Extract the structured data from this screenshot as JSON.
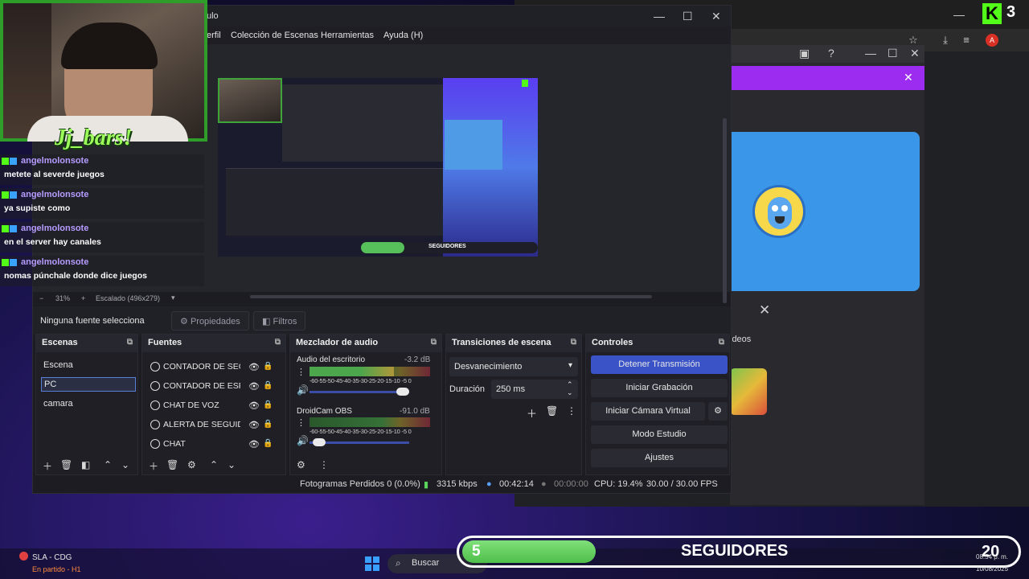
{
  "browser": {
    "profile_initial": "A",
    "kick_count": "3"
  },
  "dialog": {
    "videos_text": "ideos"
  },
  "obs": {
    "title": "ulo",
    "menu": [
      "erfil",
      "Colección de Escenas",
      "Herramientas",
      "Ayuda (H)"
    ],
    "zoom": "31%",
    "scale_label": "Escalado (496x279)",
    "no_source": "Ninguna fuente seleccionada",
    "properties_btn": "Propiedades",
    "filters_btn": "Filtros",
    "docks": {
      "scenes": "Escenas",
      "sources": "Fuentes",
      "mixer": "Mezclador de audio",
      "transitions": "Transiciones de escena",
      "controls": "Controles"
    },
    "scenes": [
      "Escena",
      "PC",
      "camara"
    ],
    "sources": [
      "CONTADOR DE SEGUIDORES",
      "CONTADOR DE ESPECTADORES",
      "CHAT DE VOZ",
      "ALERTA DE SEGUIDORES",
      "CHAT"
    ],
    "mixer": [
      {
        "name": "Audio del escritorio",
        "db": "-3.2 dB",
        "level": 0.7
      },
      {
        "name": "DroidCam OBS",
        "db": "-91.0 dB",
        "level": 0.0
      }
    ],
    "meter_scale": "-60-55-50-45-40-35-30-25-20-15-10 -5  0",
    "transition": "Desvanecimiento",
    "duration_label": "Duración",
    "duration_value": "250 ms",
    "controls": [
      "Detener Transmisión",
      "Iniciar Grabación",
      "Iniciar Cámara Virtual",
      "Modo Estudio",
      "Ajustes"
    ],
    "status": {
      "dropped": "Fotogramas Perdidos 0 (0.0%)",
      "bitrate": "3315 kbps",
      "live_time": "00:42:14",
      "rec_time": "00:00:00",
      "cpu": "CPU: 19.4%",
      "fps": "30.00 / 30.00 FPS"
    }
  },
  "overlay": {
    "cam_name": "Jj_bars!",
    "chat": [
      {
        "user": "angelmolonsote",
        "msg": "metete al severde juegos"
      },
      {
        "user": "angelmolonsote",
        "msg": "ya supiste como"
      },
      {
        "user": "angelmolonsote",
        "msg": "en el server hay canales"
      },
      {
        "user": "angelmolonsote",
        "msg": "nomas púnchale donde dice juegos"
      }
    ],
    "followers": {
      "current": "5",
      "label": "SEGUIDORES",
      "goal": "20",
      "progress": 0.25
    },
    "mini_followers_label": "SEGUIDORES"
  },
  "taskbar": {
    "game_title": "SLA - CDG",
    "game_status": "En partido - H1",
    "search_label": "Buscar",
    "time": "08:54 p. m.",
    "date": "10/08/2025"
  },
  "colors": {
    "accent": "#3a54c8",
    "kick_green": "#53fc18",
    "purple": "#9b2cf0"
  }
}
